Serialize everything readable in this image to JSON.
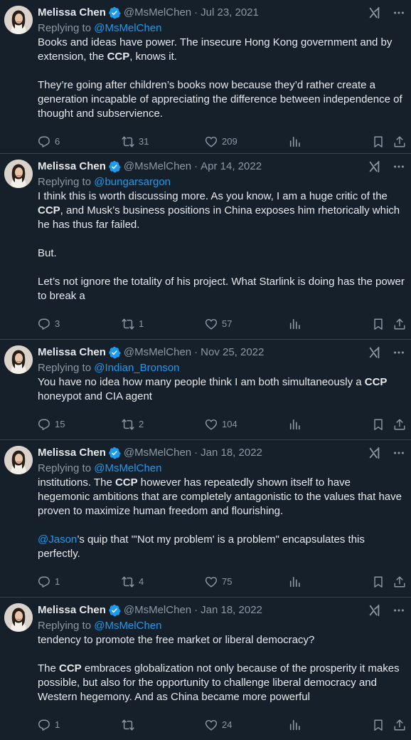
{
  "author": {
    "name": "Melissa Chen",
    "handle": "@MsMelChen"
  },
  "colors": {
    "background": "#15202b",
    "text": "#e7e9ea",
    "muted": "#8b98a5",
    "accent": "#1d9bf0",
    "divider": "#38444d"
  },
  "icons": {
    "verified": "verified-badge-icon",
    "grok": "grok-icon",
    "more": "more-icon",
    "reply": "reply-icon",
    "retweet": "retweet-icon",
    "like": "like-icon",
    "views": "views-icon",
    "bookmark": "bookmark-icon",
    "share": "share-icon"
  },
  "tweets": [
    {
      "date": "Jul 23, 2021",
      "replying_prefix": "Replying to ",
      "replying_to": "@MsMelChen",
      "p1": {
        "a": "Books and ideas have power. The insecure Hong Kong government and by extension, the ",
        "b": "CCP",
        "c": ", knows it."
      },
      "p2": "They’re going after children’s books now because they’d rather create a generation incapable of appreciating the difference between independence of thought and subservience.",
      "replies": "6",
      "retweets": "31",
      "likes": "209"
    },
    {
      "date": "Apr 14, 2022",
      "replying_prefix": "Replying to ",
      "replying_to": "@bungarsargon",
      "p1": {
        "a": "I think this is worth discussing more. As you know, I am a huge critic of the ",
        "b": "CCP",
        "c": ", and Musk’s business positions in China exposes him rhetorically which he has thus far failed."
      },
      "p2": "But.",
      "p3": "Let’s not ignore the totality of his project. What Starlink is doing has the power to break a",
      "replies": "3",
      "retweets": "1",
      "likes": "57"
    },
    {
      "date": "Nov 25, 2022",
      "replying_prefix": "Replying to ",
      "replying_to": "@Indian_Bronson",
      "p1": {
        "a": "You have no idea how many people think I am both simultaneously a ",
        "b": "CCP",
        "c": " honeypot and CIA agent"
      },
      "replies": "15",
      "retweets": "2",
      "likes": "104"
    },
    {
      "date": "Jan 18, 2022",
      "replying_prefix": "Replying to ",
      "replying_to": "@MsMelChen",
      "p1": {
        "a": "institutions. The ",
        "b": "CCP",
        "c": " however has repeatedly shown itself to have hegemonic ambitions that are completely antagonistic to the values that have proven to maximize human freedom and flourishing."
      },
      "p2": {
        "mention": "@Jason",
        "rest": "’s quip that \"'Not my problem' is a problem\" encapsulates this perfectly."
      },
      "replies": "1",
      "retweets": "4",
      "likes": "75"
    },
    {
      "date": "Jan 18, 2022",
      "replying_prefix": "Replying to ",
      "replying_to": "@MsMelChen",
      "p1": "tendency to promote the free market or liberal democracy?",
      "p2": {
        "a": "The ",
        "b": "CCP",
        "c": " embraces globalization not only because of the prosperity it makes possible, but also for the opportunity to challenge liberal democracy and Western hegemony. And as China became more powerful"
      },
      "replies": "1",
      "retweets": "",
      "likes": "24"
    }
  ]
}
